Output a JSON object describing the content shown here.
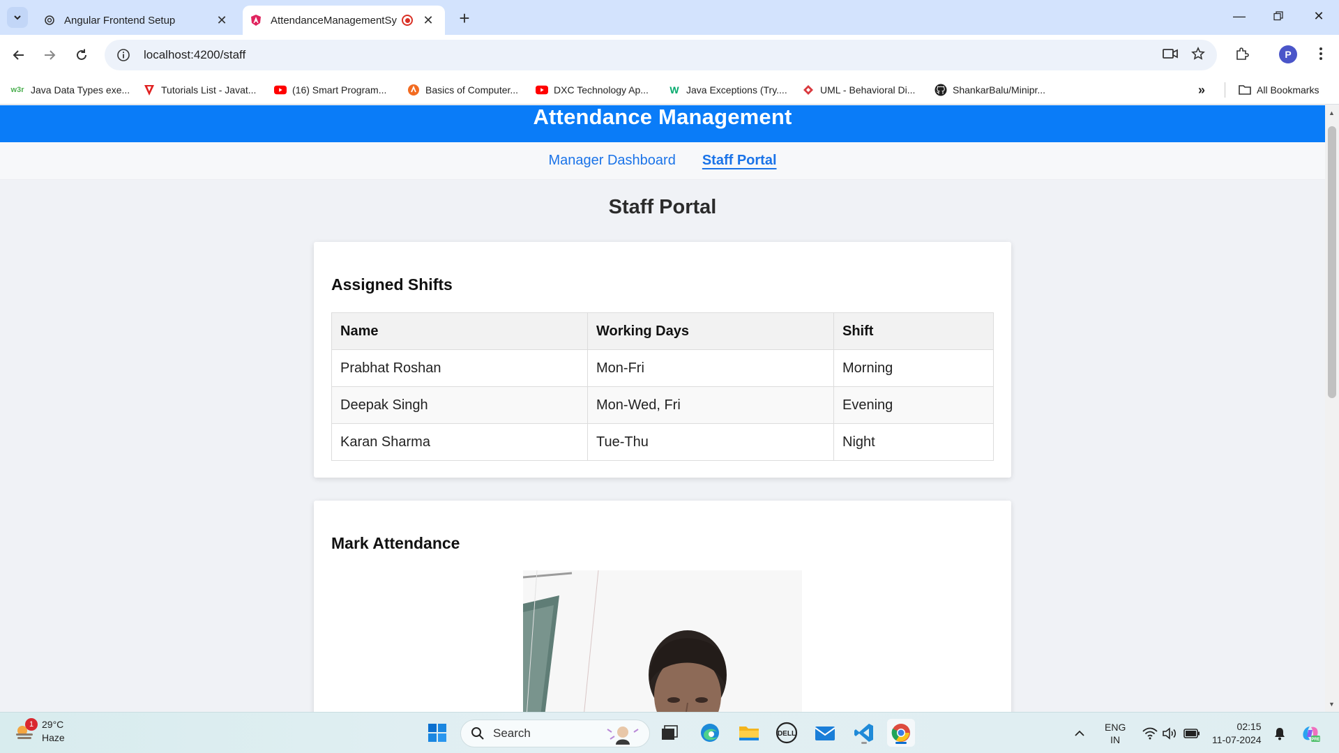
{
  "browser": {
    "tabs": [
      {
        "title": "Angular Frontend Setup",
        "active": false
      },
      {
        "title": "AttendanceManagementSy",
        "active": true
      }
    ],
    "url": "localhost:4200/staff",
    "profile_initial": "P",
    "bookmarks": [
      {
        "label": "Java Data Types exe...",
        "icon": "w3schools-icon"
      },
      {
        "label": "Tutorials List - Javat...",
        "icon": "javatpoint-icon"
      },
      {
        "label": "(16) Smart Program...",
        "icon": "youtube-icon"
      },
      {
        "label": "Basics of Computer...",
        "icon": "orange-logo-icon"
      },
      {
        "label": "DXC Technology Ap...",
        "icon": "youtube-icon"
      },
      {
        "label": "Java Exceptions (Try....",
        "icon": "w3schools-green-icon"
      },
      {
        "label": "UML - Behavioral Di...",
        "icon": "diamond-logo-icon"
      },
      {
        "label": "ShankarBalu/Minipr...",
        "icon": "github-icon"
      }
    ],
    "all_bookmarks": "All Bookmarks"
  },
  "app": {
    "header_title": "Attendance Management",
    "nav": [
      {
        "label": "Manager Dashboard",
        "active": false
      },
      {
        "label": "Staff Portal",
        "active": true
      }
    ],
    "page_title": "Staff Portal",
    "assigned_shifts": {
      "title": "Assigned Shifts",
      "columns": [
        "Name",
        "Working Days",
        "Shift"
      ],
      "rows": [
        [
          "Prabhat Roshan",
          "Mon-Fri",
          "Morning"
        ],
        [
          "Deepak Singh",
          "Mon-Wed, Fri",
          "Evening"
        ],
        [
          "Karan Sharma",
          "Tue-Thu",
          "Night"
        ]
      ]
    },
    "mark_attendance": {
      "title": "Mark Attendance"
    }
  },
  "taskbar": {
    "weather_temp": "29°C",
    "weather_desc": "Haze",
    "weather_badge": "1",
    "search_placeholder": "Search",
    "lang_top": "ENG",
    "lang_bottom": "IN",
    "time": "02:15",
    "date": "11-07-2024"
  },
  "colors": {
    "header_bg": "#0a7cf8",
    "link": "#1a73e8",
    "page_bg": "#f0f2f6"
  }
}
